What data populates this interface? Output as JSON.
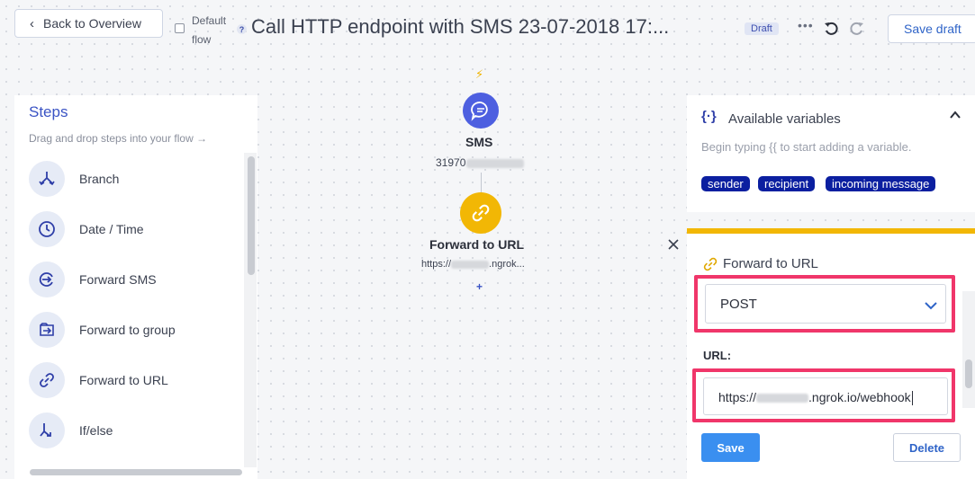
{
  "header": {
    "back_label": "Back to Overview",
    "default_flow_label_line1": "Default",
    "default_flow_label_line2": "flow",
    "help_glyph": "?",
    "title": "Call HTTP endpoint with SMS 23-07-2018 17:...",
    "status_badge": "Draft",
    "more_glyph": "•••",
    "save_draft_label": "Save draft"
  },
  "steps": {
    "title": "Steps",
    "subtitle": "Drag and drop steps into your flow →",
    "items": [
      {
        "label": "Branch",
        "icon": "branch-icon"
      },
      {
        "label": "Date / Time",
        "icon": "clock-icon"
      },
      {
        "label": "Forward SMS",
        "icon": "forward-sms-icon"
      },
      {
        "label": "Forward to group",
        "icon": "forward-group-icon"
      },
      {
        "label": "Forward to URL",
        "icon": "link-icon"
      },
      {
        "label": "If/else",
        "icon": "if-else-icon"
      }
    ]
  },
  "canvas": {
    "trigger_glyph": "⚡",
    "sms_node": {
      "label": "SMS",
      "number_prefix": "31970"
    },
    "url_node": {
      "label": "Forward to URL",
      "sub_prefix": "https://",
      "sub_suffix": ".ngrok..."
    },
    "add_glyph": "+"
  },
  "variables": {
    "icon_glyph": "{·}",
    "title": "Available variables",
    "hint": "Begin typing {{ to start adding a variable.",
    "chips": [
      "sender",
      "recipient",
      "incoming message"
    ]
  },
  "config": {
    "title": "Forward to URL",
    "method_value": "POST",
    "url_label": "URL:",
    "url_prefix": "https://",
    "url_suffix": ".ngrok.io/webhook",
    "save_label": "Save",
    "delete_label": "Delete"
  },
  "colors": {
    "accent": "#3a53c4",
    "highlight": "#f0366a",
    "node_yellow": "#f2b705",
    "node_blue": "#4d5fe0",
    "chip_bg": "#0b1fa0",
    "save_btn": "#3a8ff0"
  }
}
